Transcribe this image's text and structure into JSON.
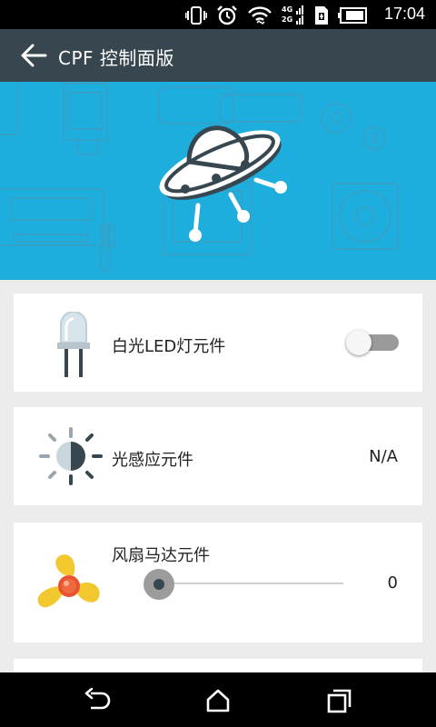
{
  "status_bar": {
    "time": "17:04",
    "icons": [
      "vibrate-icon",
      "alarm-icon",
      "wifi-icon",
      "4g-signal-icon",
      "2g-signal-icon",
      "sim-icon",
      "battery-icon"
    ],
    "network_labels": [
      "4G",
      "2G"
    ]
  },
  "app_bar": {
    "back_icon": "arrow-left-icon",
    "title": "CPF 控制面版"
  },
  "hero": {
    "icon": "ufo-icon",
    "background_color": "#1eaede"
  },
  "components": [
    {
      "icon": "led-icon",
      "label": "白光LED灯元件",
      "control": "toggle",
      "on": false
    },
    {
      "icon": "light-sensor-icon",
      "label": "光感应元件",
      "value": "N/A"
    },
    {
      "icon": "fan-icon",
      "label": "风扇马达元件",
      "control": "slider",
      "slider_value": 0,
      "value": "0"
    }
  ],
  "nav_bar": {
    "icons": [
      "back-icon",
      "home-icon",
      "recents-icon"
    ]
  }
}
